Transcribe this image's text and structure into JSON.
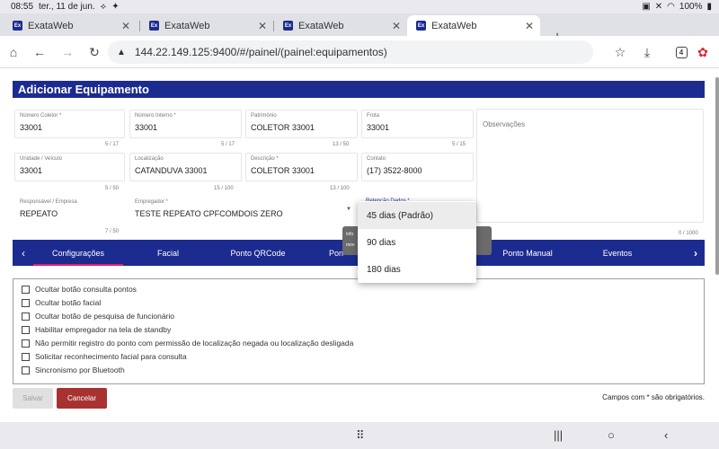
{
  "status_bar": {
    "time": "08:55",
    "date": "ter., 11 de jun.",
    "battery": "100%"
  },
  "browser": {
    "tabs": [
      {
        "label": "ExataWeb",
        "favicon": "Ex",
        "active": false
      },
      {
        "label": "ExataWeb",
        "favicon": "Ex",
        "active": false
      },
      {
        "label": "ExataWeb",
        "favicon": "Ex",
        "active": false
      },
      {
        "label": "ExataWeb",
        "favicon": "Ex",
        "active": true
      }
    ],
    "url": "144.22.149.125:9400/#/painel/(painel:equipamentos)",
    "tab_count": "4"
  },
  "page": {
    "title": "Adicionar Equipamento",
    "fields": {
      "numero_coletor": {
        "label": "Número Coletor *",
        "value": "33001",
        "counter": "5 / 17"
      },
      "numero_interno": {
        "label": "Número Interno *",
        "value": "33001",
        "counter": "5 / 17"
      },
      "patrimonio": {
        "label": "Patrimônio",
        "value": "COLETOR 33001",
        "counter": "13 / 50"
      },
      "frota": {
        "label": "Frota",
        "value": "33001",
        "counter": "5 / 15"
      },
      "unidade_veiculo": {
        "label": "Unidade / Veículo",
        "value": "33001",
        "counter": "5 / 50"
      },
      "localizacao": {
        "label": "Localização",
        "value": "CATANDUVA 33001",
        "counter": "15 / 100"
      },
      "descricao": {
        "label": "Descrição *",
        "value": "COLETOR 33001",
        "counter": "13 / 100"
      },
      "contato": {
        "label": "Contato",
        "value": "(17) 3522-8000",
        "counter": ""
      },
      "responsavel": {
        "label": "Responsável / Empresa",
        "value": "REPEATO",
        "counter": "7 / 50"
      },
      "empregador": {
        "label": "Empregador *",
        "value": "TESTE REPEATO CPFCOMDOIS ZERO"
      },
      "retencao": {
        "label": "Retenção Dados *",
        "value": ""
      },
      "observacoes": {
        "label": "Observações",
        "counter": "0 / 1000"
      }
    },
    "tooltip_lines": [
      "Info",
      "mov"
    ],
    "dropdown_options": [
      {
        "label": "45 dias (Padrão)",
        "selected": true
      },
      {
        "label": "90 dias",
        "selected": false
      },
      {
        "label": "180 dias",
        "selected": false
      }
    ],
    "nav_tabs": [
      {
        "label": "Configurações",
        "active": true
      },
      {
        "label": "Facial",
        "active": false
      },
      {
        "label": "Ponto QRCode",
        "active": false
      },
      {
        "label": "Pon",
        "active": false
      },
      {
        "label": "Ponto Manual",
        "active": false
      },
      {
        "label": "Eventos",
        "active": false
      }
    ],
    "checkboxes": [
      "Ocultar botão consulta pontos",
      "Ocultar botão facial",
      "Ocultar botão de pesquisa de funcionário",
      "Habilitar empregador na tela de standby",
      "Não permitir registro do ponto com permissão de localização negada ou localização desligada",
      "Solicitar reconhecimento facial para consulta",
      "Sincronismo por Bluetooth"
    ],
    "buttons": {
      "save": "Salvar",
      "cancel": "Cancelar"
    },
    "required_note": "Campos com * são obrigatórios."
  },
  "colors": {
    "primary": "#1c2b8f",
    "cancel": "#a83232",
    "accent": "#e91e63"
  }
}
